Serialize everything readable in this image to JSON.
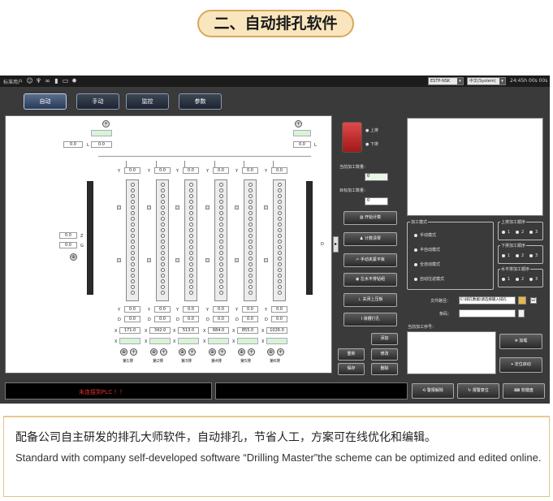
{
  "heading": "二、自动排孔软件",
  "app": {
    "user": "标准用户",
    "topbar_icons": [
      "user-icon",
      "wifi-icon",
      "link-icon",
      "phone-icon",
      "monitor-icon",
      "gear-icon"
    ],
    "device_select": "ESTP-NSK",
    "language_select": "中文(System)",
    "clock": "24:45h 00s 00s",
    "nav": [
      {
        "label": "自动",
        "active": true
      },
      {
        "label": "手动",
        "active": false
      },
      {
        "label": "监控",
        "active": false
      },
      {
        "label": "参数",
        "active": false
      }
    ],
    "canvas": {
      "left_top_values": [
        "0.0",
        "0.0"
      ],
      "left_top_unit": "L",
      "right_top_values": [
        "0.0",
        "L"
      ],
      "y_top_values": [
        "0.0",
        "0.0",
        "0.0",
        "0.0",
        "0.0",
        "0.0"
      ],
      "y_label": "Y",
      "left_mid": {
        "z": "0.0",
        "z_label": "Z",
        "g": "0.0",
        "g_label": "G"
      },
      "y_bottom_values": [
        "0.0",
        "0.0",
        "0.0",
        "0.0",
        "0.0",
        "0.0"
      ],
      "d_label": "D",
      "d_values": [
        "0.0",
        "0.0",
        "0.0",
        "0.0",
        "0.0",
        "0.0"
      ],
      "x_label": "X",
      "x_values": [
        "171.0",
        "342.0",
        "513.0",
        "684.0",
        "855.0",
        "1026.0"
      ],
      "rows": [
        "第1排",
        "第2排",
        "第3排",
        "第4排",
        "第5排",
        "第6排"
      ],
      "side_label": "D"
    },
    "right": {
      "legend_up": "上排",
      "legend_down": "下排",
      "current_count_label": "当前加工数量：",
      "current_count": "0",
      "target_count_label": "目标加工数量：",
      "target_count": "0",
      "buttons": [
        {
          "label": "开始计数",
          "icon": "chart-icon"
        },
        {
          "label": "计数清零",
          "icon": "broom-icon"
        },
        {
          "label": "手动夹紧平板",
          "icon": "clamp-icon"
        },
        {
          "label": "左水平排钻组",
          "icon": "drill-icon"
        },
        {
          "label": "关闭上压板",
          "icon": "press-icon"
        },
        {
          "label": "滑槽打孔",
          "icon": "slot-icon"
        }
      ],
      "mode_group": {
        "title": "加工模式",
        "options": [
          "手动模式",
          "半自动模式",
          "全自动模式",
          "自动往返模式"
        ]
      },
      "upper_group": {
        "title": "上排加工顺序",
        "options": [
          "1",
          "2",
          "3"
        ]
      },
      "lower_group": {
        "title": "下排加工顺序",
        "options": [
          "1",
          "2",
          "3"
        ]
      },
      "horizontal_group": {
        "title": "水平排加工顺序",
        "options": [
          "1",
          "2",
          "3"
        ]
      },
      "file_path_label": "文件路径：",
      "file_path": "E:\\排孔数据\\请选择输入排孔",
      "barcode_label": "条码：",
      "current_no_label": "当前加工序号：",
      "small_buttons": [
        "添加",
        "重新",
        "修改",
        "保存",
        "删除"
      ],
      "load_button": "加载",
      "locate_button": "定位启动"
    },
    "status_message": "未连接到PLC ！！",
    "bottom_buttons": [
      {
        "label": "警报解除",
        "icon": "alarm-icon"
      },
      {
        "label": "报警复位",
        "icon": "reset-icon"
      },
      {
        "label": "软键盘",
        "icon": "keyboard-icon"
      }
    ]
  },
  "caption": {
    "zh": "配备公司自主研发的排孔大师软件，自动排孔，节省人工，方案可在线优化和编辑。",
    "en": "Standard with company self-developed software “Drilling Master”the scheme can be optimized and edited online."
  }
}
